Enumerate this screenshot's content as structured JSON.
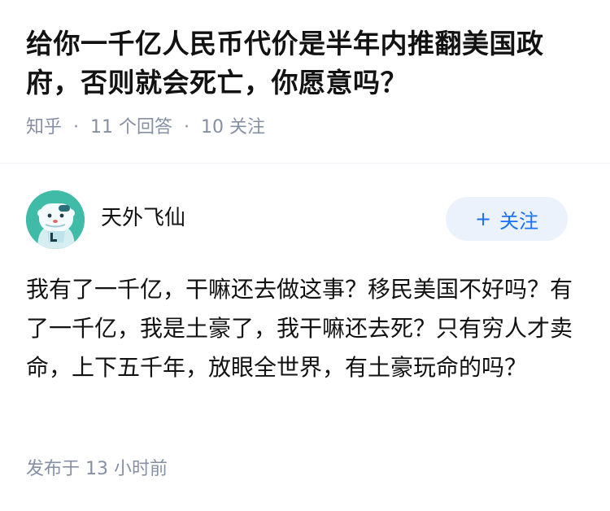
{
  "question": {
    "title": "给你一千亿人民币代价是半年内推翻美国政府，否则就会死亡，你愿意吗？",
    "source": "知乎",
    "separator": "·",
    "answers_count": "11 个回答",
    "followers_count": "10 关注"
  },
  "answer": {
    "author": {
      "name": "天外飞仙",
      "avatar_icon": "cartoon-avatar-icon"
    },
    "follow_button": {
      "plus": "+",
      "label": "关注",
      "color": "#1772f6",
      "background": "#ebf2fc"
    },
    "content": "我有了一千亿，干嘛还去做这事？移民美国不好吗？有了一千亿，我是土豪了，我干嘛还去死？只有穷人才卖命，上下五千年，放眼全世界，有土豪玩命的吗？",
    "published": "发布于 13 小时前"
  },
  "colors": {
    "meta_gray": "#8590a6",
    "text": "#121212",
    "avatar_bg": "#3fbba7"
  }
}
